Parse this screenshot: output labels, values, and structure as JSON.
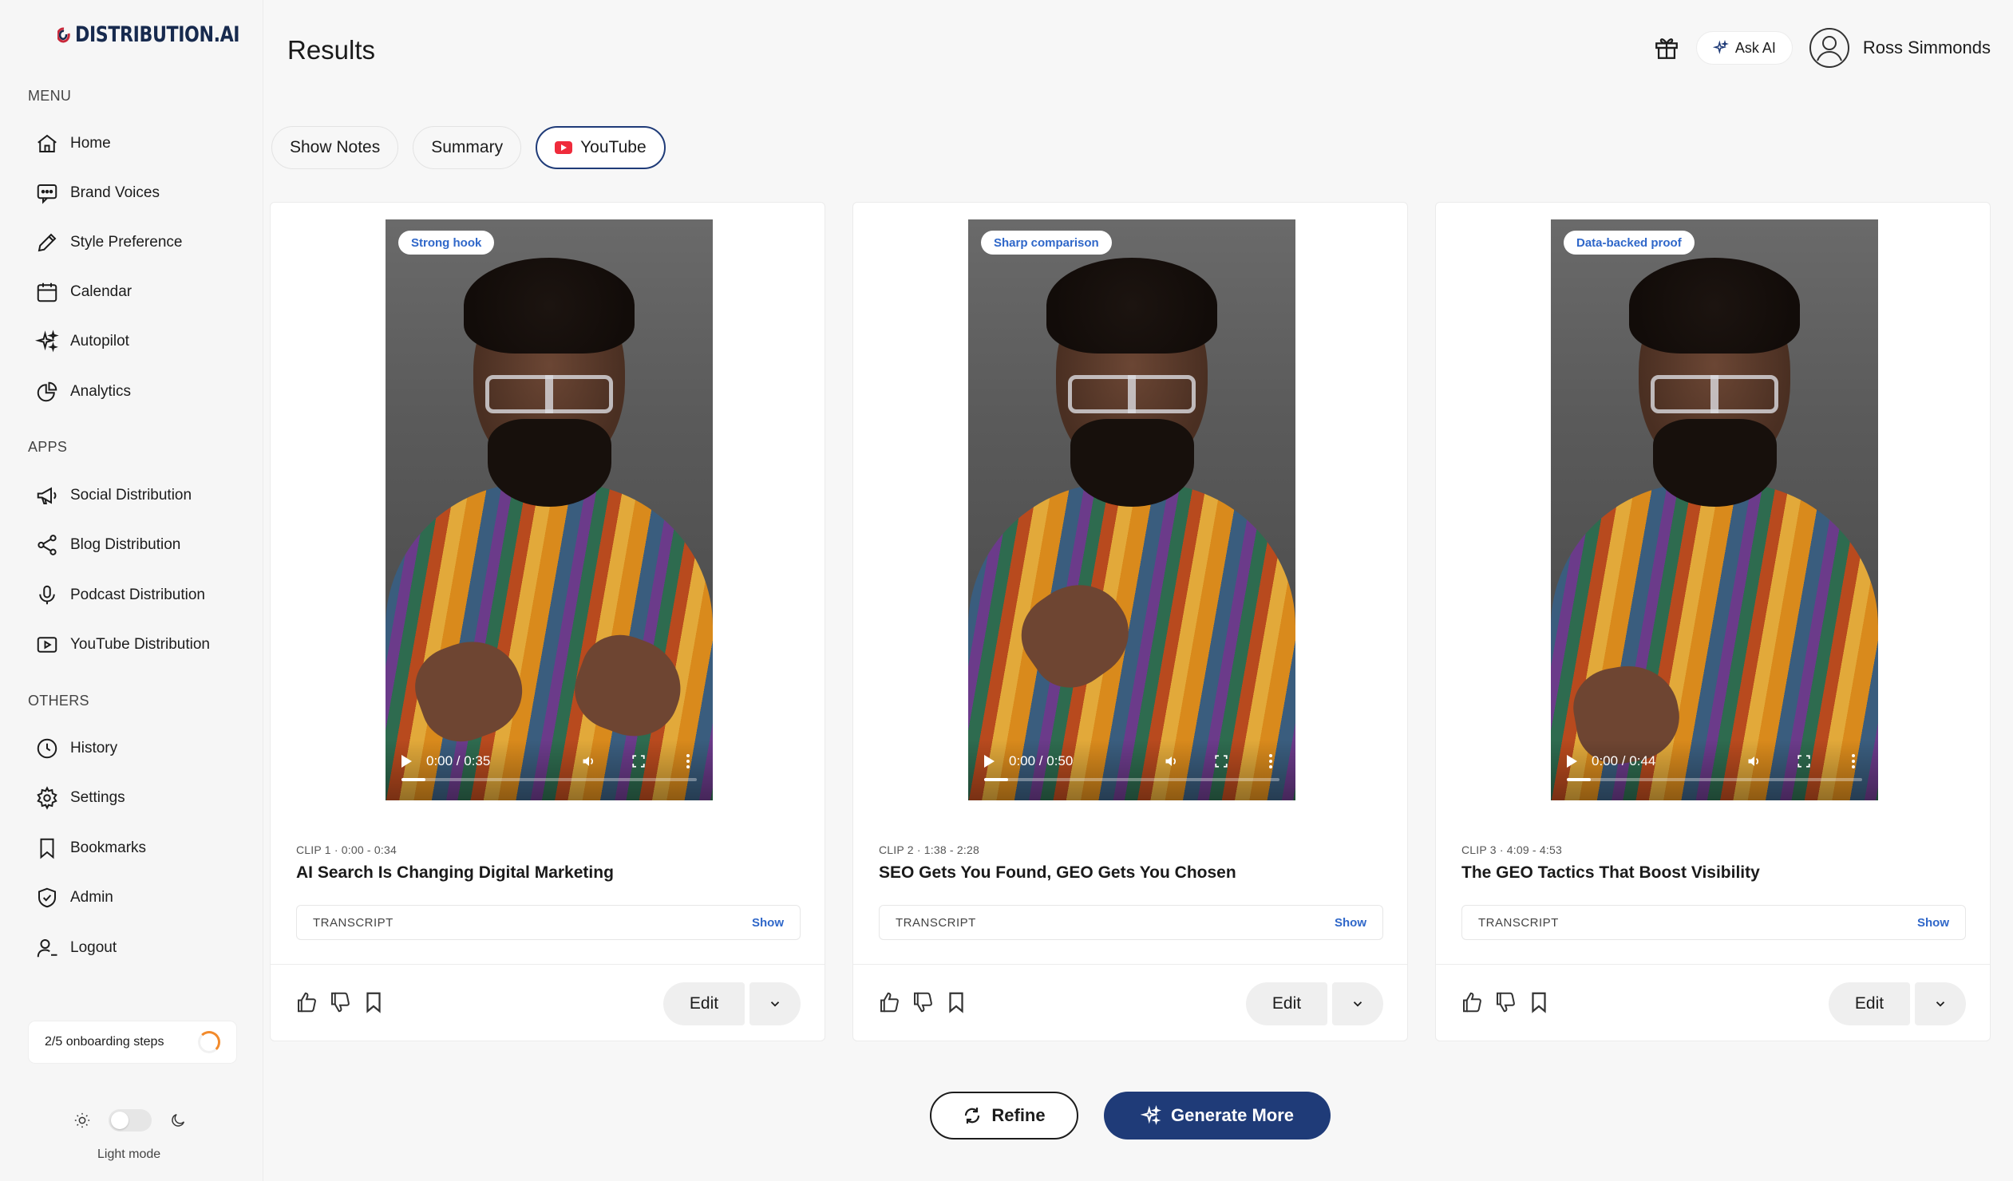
{
  "brand": {
    "name": "DISTRIBUTION.AI",
    "color": "#172a4e",
    "accent": "#1f3b78"
  },
  "sidebar": {
    "menu_label": "MENU",
    "menu_items": [
      {
        "label": "Home",
        "icon": "home-icon"
      },
      {
        "label": "Brand Voices",
        "icon": "chat-icon"
      },
      {
        "label": "Style Preference",
        "icon": "pen-icon"
      },
      {
        "label": "Calendar",
        "icon": "calendar-icon"
      },
      {
        "label": "Autopilot",
        "icon": "sparkles-icon"
      },
      {
        "label": "Analytics",
        "icon": "pie-chart-icon"
      }
    ],
    "apps_label": "APPS",
    "app_items": [
      {
        "label": "Social Distribution",
        "icon": "megaphone-icon"
      },
      {
        "label": "Blog Distribution",
        "icon": "share-icon"
      },
      {
        "label": "Podcast Distribution",
        "icon": "microphone-icon"
      },
      {
        "label": "YouTube Distribution",
        "icon": "video-icon"
      }
    ],
    "others_label": "OTHERS",
    "other_items": [
      {
        "label": "History",
        "icon": "clock-icon"
      },
      {
        "label": "Settings",
        "icon": "gear-icon"
      },
      {
        "label": "Bookmarks",
        "icon": "bookmark-icon"
      },
      {
        "label": "Admin",
        "icon": "shield-icon"
      },
      {
        "label": "Logout",
        "icon": "user-logout-icon"
      }
    ],
    "onboarding": {
      "text": "2/5 onboarding steps",
      "completed": 2,
      "total": 5
    },
    "mode_label": "Light mode"
  },
  "header": {
    "title": "Results",
    "ask_ai": "Ask AI",
    "user_name": "Ross Simmonds"
  },
  "tabs": [
    {
      "label": "Show Notes",
      "active": false
    },
    {
      "label": "Summary",
      "active": false
    },
    {
      "label": "YouTube",
      "active": true
    }
  ],
  "clips": [
    {
      "badge": "Strong hook",
      "time": "0:00 / 0:35",
      "meta": "CLIP 1 · 0:00 - 0:34",
      "title": "AI Search Is Changing Digital Marketing",
      "transcript_label": "TRANSCRIPT",
      "transcript_action": "Show",
      "edit_label": "Edit"
    },
    {
      "badge": "Sharp comparison",
      "time": "0:00 / 0:50",
      "meta": "CLIP 2 · 1:38 - 2:28",
      "title": "SEO Gets You Found, GEO Gets You Chosen",
      "transcript_label": "TRANSCRIPT",
      "transcript_action": "Show",
      "edit_label": "Edit"
    },
    {
      "badge": "Data-backed proof",
      "time": "0:00 / 0:44",
      "meta": "CLIP 3 · 4:09 - 4:53",
      "title": "The GEO Tactics That Boost Visibility",
      "transcript_label": "TRANSCRIPT",
      "transcript_action": "Show",
      "edit_label": "Edit"
    }
  ],
  "actions": {
    "refine": "Refine",
    "generate_more": "Generate More"
  }
}
